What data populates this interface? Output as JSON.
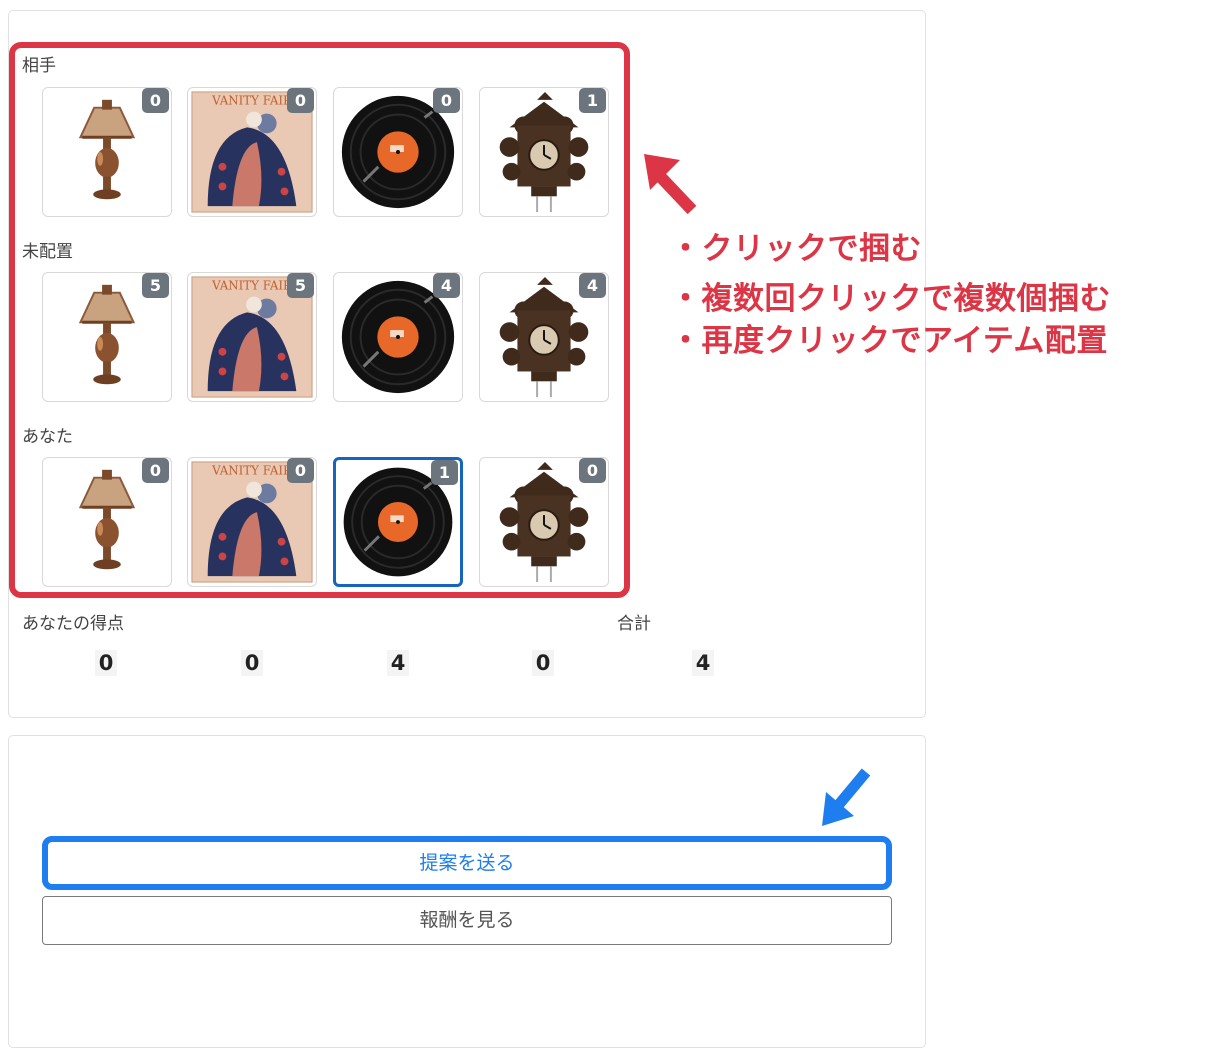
{
  "rows": [
    {
      "label": "相手",
      "counts": [
        "0",
        "0",
        "0",
        "1"
      ]
    },
    {
      "label": "未配置",
      "counts": [
        "5",
        "5",
        "4",
        "4"
      ]
    },
    {
      "label": "あなた",
      "counts": [
        "0",
        "0",
        "1",
        "0"
      ]
    }
  ],
  "items": [
    {
      "name": "lamp",
      "icon": "lamp-icon"
    },
    {
      "name": "magazine",
      "icon": "magazine-icon",
      "text": "VANITY FAIR"
    },
    {
      "name": "record",
      "icon": "record-icon"
    },
    {
      "name": "clock",
      "icon": "cuckoo-clock-icon"
    }
  ],
  "selected": {
    "row": 2,
    "col": 2
  },
  "score": {
    "label": "あなたの得点",
    "total_label": "合計",
    "values": [
      "0",
      "0",
      "4",
      "0"
    ],
    "total": "4"
  },
  "annotations": {
    "lines": [
      "・クリックで掴む",
      "・複数回クリックで複数個掴む",
      "・再度クリックでアイテム配置"
    ]
  },
  "buttons": {
    "send": "提案を送る",
    "reward": "報酬を見る"
  },
  "colors": {
    "highlight_red": "#dc3545",
    "highlight_blue": "#1e7ef0",
    "badge": "#6c757d",
    "selected_border": "#1565c0"
  }
}
